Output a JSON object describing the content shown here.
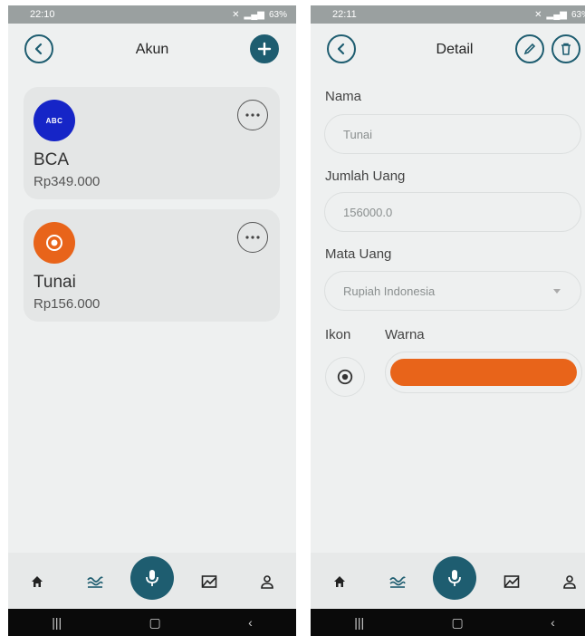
{
  "left": {
    "status": {
      "time": "22:10",
      "battery": "63%"
    },
    "header": {
      "title": "Akun",
      "back_icon": "chevron-left-icon",
      "add_icon": "plus-icon"
    },
    "accounts": [
      {
        "name": "BCA",
        "amount": "Rp349.000",
        "icon_text": "ABC",
        "icon_color": "#1625c7"
      },
      {
        "name": "Tunai",
        "amount": "Rp156.000",
        "icon": "coin-icon",
        "icon_color": "#e8641a"
      }
    ]
  },
  "right": {
    "status": {
      "time": "22:11",
      "battery": "63%"
    },
    "header": {
      "title": "Detail",
      "back_icon": "chevron-left-icon",
      "edit_icon": "pencil-icon",
      "delete_icon": "trash-icon"
    },
    "form": {
      "name_label": "Nama",
      "name_value": "Tunai",
      "amount_label": "Jumlah Uang",
      "amount_value": "156000.0",
      "currency_label": "Mata Uang",
      "currency_value": "Rupiah Indonesia",
      "icon_label": "Ikon",
      "color_label": "Warna",
      "color_value": "#e8641a"
    }
  },
  "nav": {
    "items": [
      "home-icon",
      "waves-icon",
      "mic-icon",
      "chart-icon",
      "profile-icon"
    ],
    "accent": "#1e5d70"
  }
}
